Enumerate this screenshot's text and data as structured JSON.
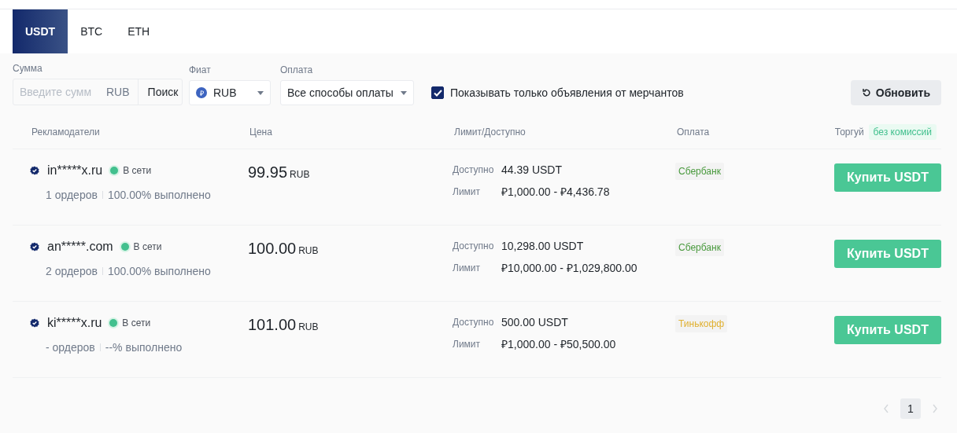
{
  "tabs": [
    {
      "label": "USDT",
      "selected": true
    },
    {
      "label": "BTC",
      "selected": false
    },
    {
      "label": "ETH",
      "selected": false
    }
  ],
  "filters": {
    "amount": {
      "label": "Сумма",
      "placeholder": "Введите сумм",
      "currency": "RUB",
      "search_button": "Поиск"
    },
    "fiat": {
      "label": "Фиат",
      "value": "RUB",
      "symbol": "₽"
    },
    "payment": {
      "label": "Оплата",
      "value": "Все способы оплаты"
    },
    "merchants_only": {
      "label": "Показывать только объявления от мерчантов",
      "checked": true
    },
    "refresh_button": "Обновить"
  },
  "table": {
    "columns": [
      "Рекламодатели",
      "Цена",
      "Лимит/Доступно",
      "Оплата",
      "Торгуй"
    ],
    "fee_badge": "без комиссий",
    "rows": [
      {
        "advertiser": "in*****x.ru",
        "status": "В сети",
        "orders": "1 ордеров",
        "completion": "100.00% выполнено",
        "price": "99.95",
        "price_currency": "RUB",
        "available_label": "Доступно",
        "available": "44.39 USDT",
        "limit_label": "Лимит",
        "limit": "₽1,000.00 - ₽4,436.78",
        "payment": {
          "label": "Сбербанк",
          "color": "#4a9a3e"
        },
        "button": "Купить USDT"
      },
      {
        "advertiser": "an*****.com",
        "status": "В сети",
        "orders": "2 ордеров",
        "completion": "100.00% выполнено",
        "price": "100.00",
        "price_currency": "RUB",
        "available_label": "Доступно",
        "available": "10,298.00 USDT",
        "limit_label": "Лимит",
        "limit": "₽10,000.00 - ₽1,029,800.00",
        "payment": {
          "label": "Сбербанк",
          "color": "#4a9a3e"
        },
        "button": "Купить USDT"
      },
      {
        "advertiser": "ki*****x.ru",
        "status": "В сети",
        "orders": "- ордеров",
        "completion": "--% выполнено",
        "price": "101.00",
        "price_currency": "RUB",
        "available_label": "Доступно",
        "available": "500.00 USDT",
        "limit_label": "Лимит",
        "limit": "₽1,000.00 - ₽50,500.00",
        "payment": {
          "label": "Тинькофф",
          "color": "#e0b030"
        },
        "button": "Купить USDT"
      }
    ]
  },
  "pagination": {
    "pages": [
      {
        "label": "1",
        "selected": true
      }
    ]
  }
}
